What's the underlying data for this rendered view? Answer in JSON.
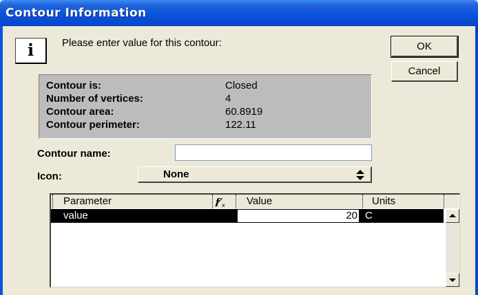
{
  "window": {
    "title": "Contour Information"
  },
  "prompt": {
    "text": "Please enter value for this contour:"
  },
  "buttons": {
    "ok": "OK",
    "cancel": "Cancel"
  },
  "contour": {
    "is_label": "Contour is:",
    "is_value": "Closed",
    "vertices_label": "Number of vertices:",
    "vertices_value": "4",
    "area_label": "Contour area:",
    "area_value": "60.8919",
    "perimeter_label": "Contour perimeter:",
    "perimeter_value": "122.11"
  },
  "fields": {
    "name_label": "Contour name:",
    "name_value": "",
    "icon_label": "Icon:",
    "icon_value": "None"
  },
  "grid": {
    "columns": [
      "Parameter",
      "Value",
      "Units"
    ],
    "rows": [
      {
        "parameter": "value",
        "value": "20",
        "units": "C"
      }
    ]
  },
  "icons": {
    "info": "i"
  }
}
